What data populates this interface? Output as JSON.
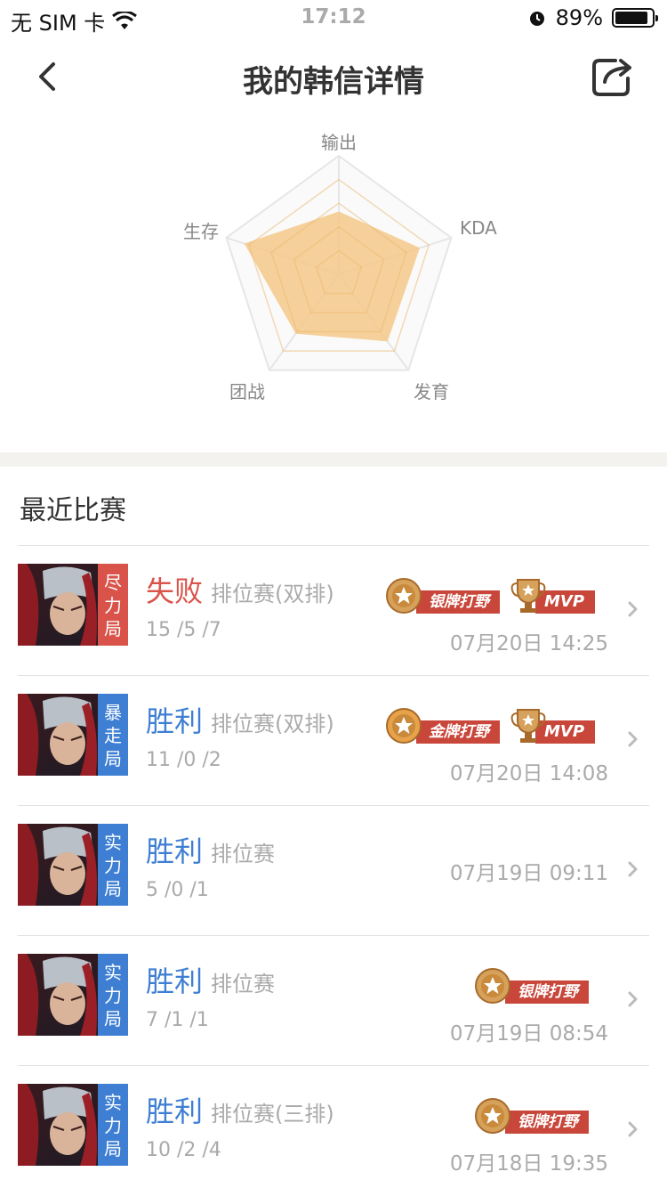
{
  "status_bar": {
    "carrier": "无 SIM 卡",
    "time": "17:12",
    "battery": "89%",
    "battery_level": 0.89
  },
  "nav": {
    "title": "我的韩信详情"
  },
  "radar": {
    "labels": [
      "输出",
      "KDA",
      "发育",
      "团战",
      "生存"
    ],
    "values": [
      0.53,
      0.72,
      0.7,
      0.62,
      0.84
    ],
    "fill_color": "#f5c888",
    "grid_color": "#e6e6e6"
  },
  "recent": {
    "title": "最近比赛"
  },
  "matches": [
    {
      "tier": "尽力局",
      "tier_color": "red",
      "result": "失败",
      "result_type": "lose",
      "mode": "排位赛(双排)",
      "kda": "15 /5 /7",
      "time": "07月20日 14:25",
      "medal": "银牌打野",
      "medal_type": "silver",
      "mvp": "MVP"
    },
    {
      "tier": "暴走局",
      "tier_color": "blue",
      "result": "胜利",
      "result_type": "win",
      "mode": "排位赛(双排)",
      "kda": "11 /0 /2",
      "time": "07月20日 14:08",
      "medal": "金牌打野",
      "medal_type": "gold",
      "mvp": "MVP"
    },
    {
      "tier": "实力局",
      "tier_color": "blue",
      "result": "胜利",
      "result_type": "win",
      "mode": "排位赛",
      "kda": "5 /0 /1",
      "time": "07月19日 09:11",
      "medal": "",
      "medal_type": "",
      "mvp": ""
    },
    {
      "tier": "实力局",
      "tier_color": "blue",
      "result": "胜利",
      "result_type": "win",
      "mode": "排位赛",
      "kda": "7 /1 /1",
      "time": "07月19日 08:54",
      "medal": "银牌打野",
      "medal_type": "silver",
      "mvp": ""
    },
    {
      "tier": "实力局",
      "tier_color": "blue",
      "result": "胜利",
      "result_type": "win",
      "mode": "排位赛(三排)",
      "kda": "10 /2 /4",
      "time": "07月18日 19:35",
      "medal": "银牌打野",
      "medal_type": "silver",
      "mvp": ""
    }
  ]
}
